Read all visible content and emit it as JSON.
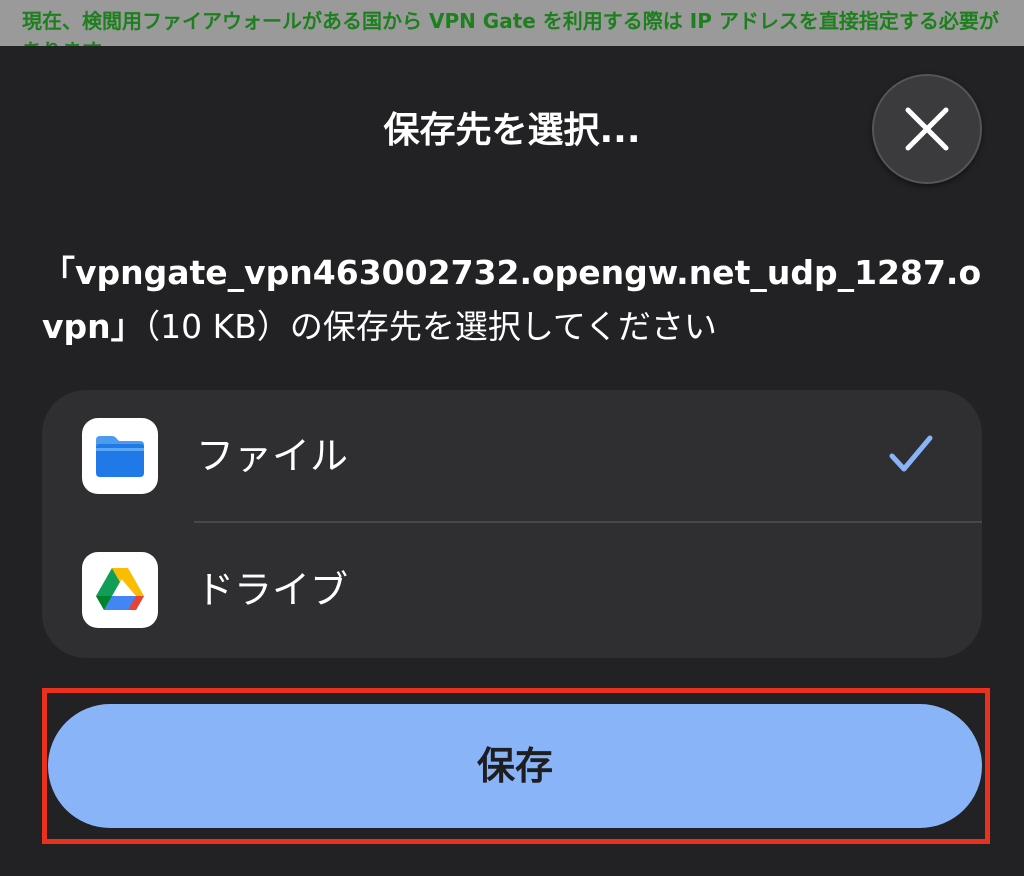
{
  "banner": {
    "text": "現在、検閲用ファイアウォールがある国から VPN Gate を利用する際は IP アドレスを直接指定する必要が",
    "text_continued": "あります",
    "color": "#1e7f1e"
  },
  "sheet": {
    "title": "保存先を選択...",
    "close_icon": "close-icon",
    "description_line1": "「vpngate_vpn463002732.opengw.net_udp_1287.o",
    "description_line2_bold": "vpn」",
    "description_line2_rest": "（10 KB）の保存先を選択してください"
  },
  "options": [
    {
      "label": "ファイル",
      "icon": "files-app-icon",
      "selected": true
    },
    {
      "label": "ドライブ",
      "icon": "google-drive-icon",
      "selected": false
    }
  ],
  "save_button": {
    "label": "保存",
    "color": "#8ab4f8"
  },
  "colors": {
    "highlight": "#e8321e",
    "check": "#8ab4f8",
    "background": "#222224"
  }
}
